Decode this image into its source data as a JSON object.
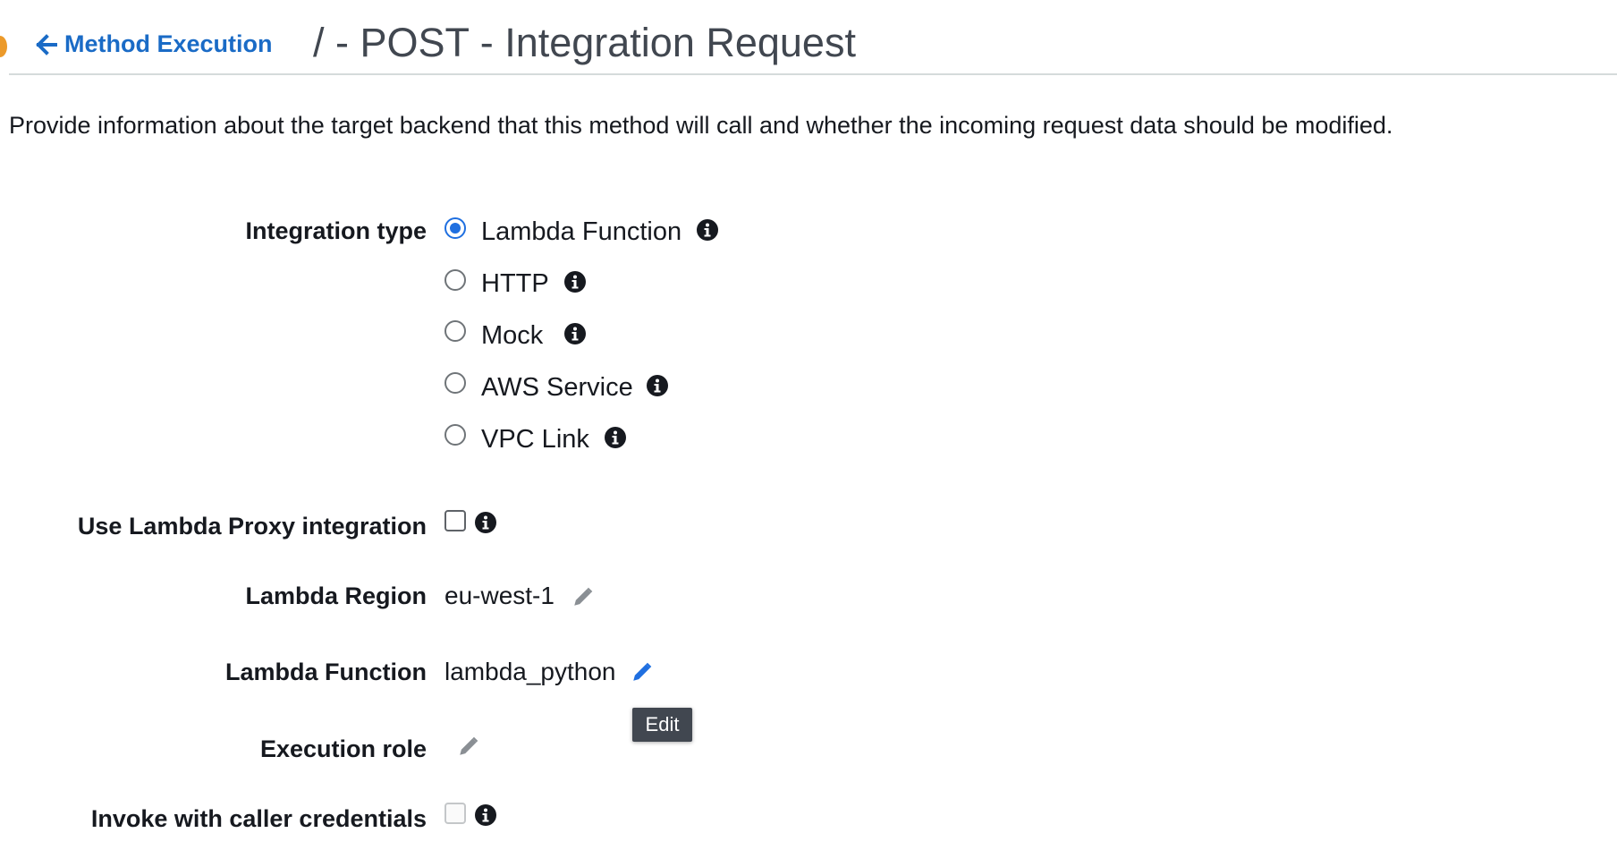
{
  "header": {
    "back_link": "Method Execution",
    "title": "/ - POST - Integration Request"
  },
  "description": "Provide information about the target backend that this method will call and whether the incoming request data should be modified.",
  "integration_type": {
    "label": "Integration type",
    "selected": "Lambda Function",
    "options": [
      "Lambda Function",
      "HTTP",
      "Mock",
      "AWS Service",
      "VPC Link"
    ]
  },
  "lambda_proxy": {
    "label": "Use Lambda Proxy integration",
    "checked": false
  },
  "lambda_region": {
    "label": "Lambda Region",
    "value": "eu-west-1"
  },
  "lambda_function": {
    "label": "Lambda Function",
    "value": "lambda_python"
  },
  "execution_role": {
    "label": "Execution role",
    "value": ""
  },
  "invoke_credentials": {
    "label": "Invoke with caller credentials",
    "checked": false
  },
  "tooltip": {
    "text": "Edit"
  },
  "colors": {
    "link": "#1a6bc6",
    "radio_selected": "#1f6fe0",
    "tooltip_bg": "#414750",
    "accent_dot": "#ec9a2a"
  },
  "icons": [
    "arrow-left-icon",
    "info-icon",
    "pencil-icon"
  ]
}
